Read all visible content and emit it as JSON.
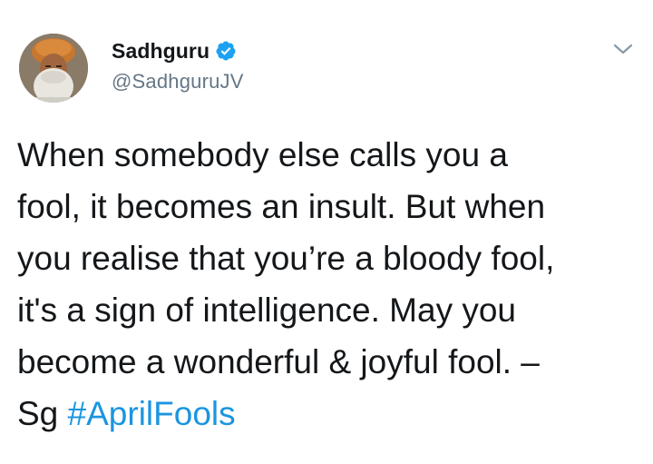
{
  "tweet": {
    "author": {
      "display_name": "Sadhguru",
      "handle": "@SadhguruJV",
      "verified": true,
      "verified_icon": "verified-badge-icon",
      "avatar": "avatar-portrait"
    },
    "menu_icon": "chevron-down-icon",
    "text_lines": [
      "When somebody else calls you a",
      "fool, it becomes an insult. But when",
      "you realise that you’re a bloody fool,",
      "it's a sign of intelligence. May you",
      "become a wonderful & joyful fool. –"
    ],
    "last_line_prefix": "Sg ",
    "hashtag": "#AprilFools"
  },
  "colors": {
    "text": "#14171a",
    "secondary": "#657786",
    "link": "#1b95e0",
    "verified": "#1da1f2"
  }
}
